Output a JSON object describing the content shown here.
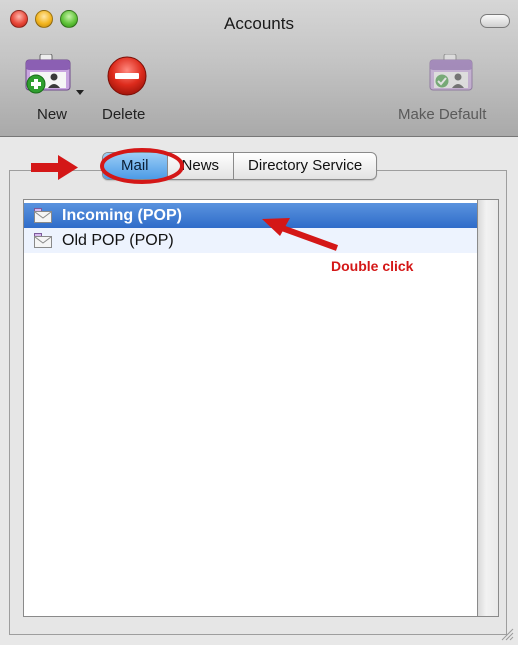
{
  "window": {
    "title": "Accounts"
  },
  "toolbar": {
    "new_label": "New",
    "delete_label": "Delete",
    "make_default_label": "Make Default"
  },
  "tabs": [
    {
      "label": "Mail",
      "selected": true
    },
    {
      "label": "News",
      "selected": false
    },
    {
      "label": "Directory Service",
      "selected": false
    }
  ],
  "accounts": [
    {
      "label": "Incoming (POP)",
      "selected": true
    },
    {
      "label": "Old POP (POP)",
      "selected": false
    }
  ],
  "annotation": {
    "text": "Double click",
    "color": "#d41717"
  },
  "colors": {
    "selection": "#3e7dd4",
    "annotation": "#d41717"
  }
}
